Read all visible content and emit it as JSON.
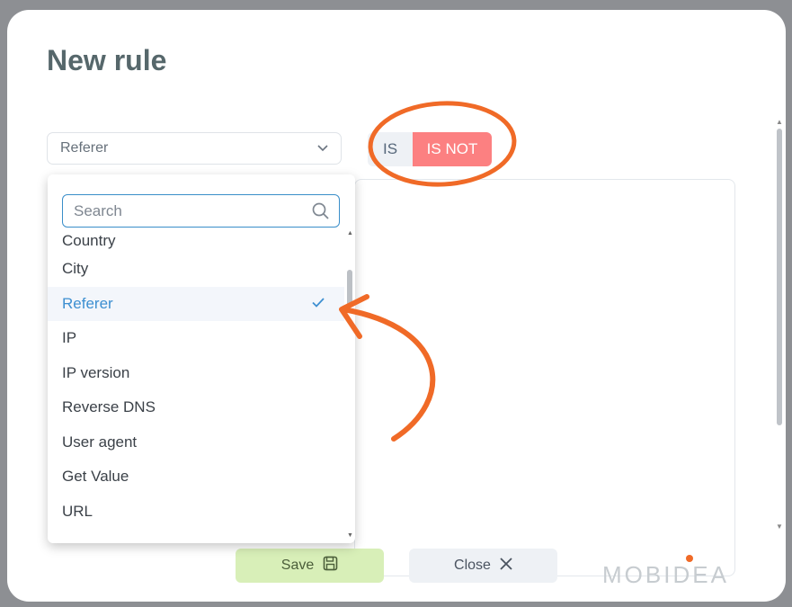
{
  "modal": {
    "title": "New rule"
  },
  "rule_select": {
    "value": "Referer"
  },
  "toggle": {
    "is_label": "IS",
    "is_not_label": "IS NOT",
    "active": "IS NOT"
  },
  "dropdown": {
    "search_placeholder": "Search",
    "items": [
      {
        "label": "Country"
      },
      {
        "label": "City"
      },
      {
        "label": "Referer",
        "selected": true
      },
      {
        "label": "IP"
      },
      {
        "label": "IP version"
      },
      {
        "label": "Reverse DNS"
      },
      {
        "label": "User agent"
      },
      {
        "label": "Get Value"
      },
      {
        "label": "URL"
      }
    ]
  },
  "buttons": {
    "save_label": "Save",
    "close_label": "Close"
  },
  "brand": {
    "logo_text": "MOBIDEA",
    "accent_color": "#f06a27"
  },
  "icons": {
    "select_chevron": "chevron-down-icon",
    "search": "search-icon",
    "check": "check-icon",
    "save": "floppy-disk-icon",
    "close": "close-icon"
  },
  "colors": {
    "is_not_active": "#fc8081",
    "save_button": "#d8efb8",
    "selected_item": "#3d8fd1",
    "annotation": "#f06a27"
  }
}
